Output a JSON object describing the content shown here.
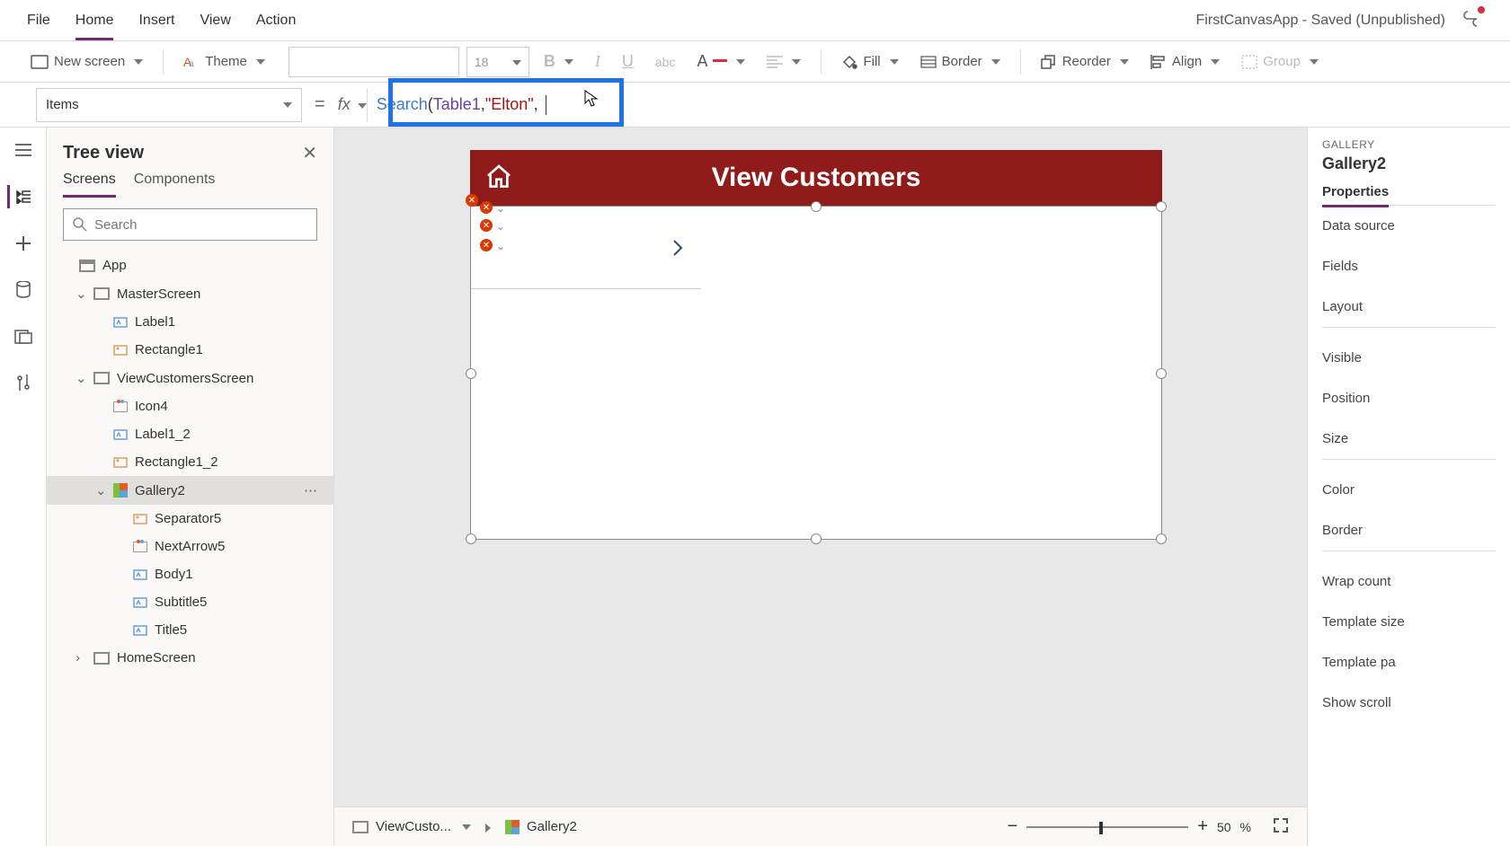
{
  "menu": {
    "items": [
      "File",
      "Home",
      "Insert",
      "View",
      "Action"
    ],
    "active": "Home"
  },
  "title": "FirstCanvasApp - Saved (Unpublished)",
  "ribbon": {
    "new_screen": "New screen",
    "theme": "Theme",
    "font_size": "18",
    "fill": "Fill",
    "border": "Border",
    "reorder": "Reorder",
    "align": "Align",
    "group": "Group"
  },
  "formula": {
    "property": "Items",
    "fx": "fx",
    "tokens": {
      "fn": "Search",
      "open": "(",
      "ident": "Table1",
      "comma": ", ",
      "str": "\"Elton\"",
      "trail": ", "
    }
  },
  "tree": {
    "title": "Tree view",
    "tabs": {
      "screens": "Screens",
      "components": "Components",
      "active": "Screens"
    },
    "search_placeholder": "Search",
    "app_label": "App",
    "items": [
      {
        "name": "MasterScreen",
        "indent": 0,
        "icon": "screen",
        "expanded": true
      },
      {
        "name": "Label1",
        "indent": 1,
        "icon": "label"
      },
      {
        "name": "Rectangle1",
        "indent": 1,
        "icon": "rect"
      },
      {
        "name": "ViewCustomersScreen",
        "indent": 0,
        "icon": "screen",
        "expanded": true
      },
      {
        "name": "Icon4",
        "indent": 1,
        "icon": "iconctl"
      },
      {
        "name": "Label1_2",
        "indent": 1,
        "icon": "label"
      },
      {
        "name": "Rectangle1_2",
        "indent": 1,
        "icon": "rect"
      },
      {
        "name": "Gallery2",
        "indent": 1,
        "icon": "gallery",
        "selected": true,
        "expanded": true
      },
      {
        "name": "Separator5",
        "indent": 2,
        "icon": "rect"
      },
      {
        "name": "NextArrow5",
        "indent": 2,
        "icon": "iconctl"
      },
      {
        "name": "Body1",
        "indent": 2,
        "icon": "label"
      },
      {
        "name": "Subtitle5",
        "indent": 2,
        "icon": "label"
      },
      {
        "name": "Title5",
        "indent": 2,
        "icon": "label"
      },
      {
        "name": "HomeScreen",
        "indent": 0,
        "icon": "screen",
        "expanded": false
      }
    ]
  },
  "canvas": {
    "header_title": "View Customers"
  },
  "breadcrumb": {
    "screen": "ViewCusto...",
    "element": "Gallery2"
  },
  "zoom": {
    "value": "50",
    "unit": "%"
  },
  "props": {
    "category": "GALLERY",
    "name": "Gallery2",
    "tab": "Properties",
    "rows": [
      "Data source",
      "Fields",
      "Layout",
      "Visible",
      "Position",
      "Size",
      "Color",
      "Border",
      "Wrap count",
      "Template size",
      "Template pa",
      "Show scroll"
    ]
  }
}
